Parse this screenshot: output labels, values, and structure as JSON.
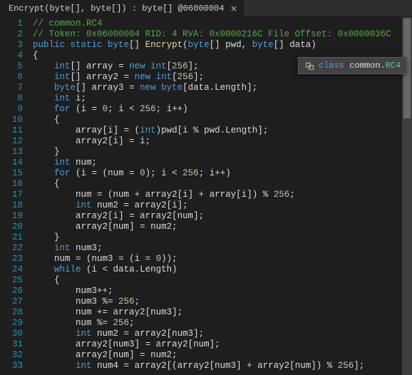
{
  "tab": {
    "title": "Encrypt(byte[], byte[]) : byte[] @06000004"
  },
  "tooltip": {
    "keyword": "class",
    "namespace": "common",
    "class_name": "RC4"
  },
  "colors": {
    "background": "#1e1e1e",
    "comment": "#57a64a",
    "keyword": "#569cd6",
    "typename": "#4ec9b0",
    "method": "#dcdcaa",
    "number": "#b5cea8",
    "linenum": "#2b91af"
  },
  "code_lines": [
    {
      "n": 1,
      "tokens": [
        [
          "comment",
          "// common.RC4"
        ]
      ]
    },
    {
      "n": 2,
      "tokens": [
        [
          "comment",
          "// Token: 0x06000004 RID: 4 RVA: 0x0000216C File Offset: 0x0000036C"
        ]
      ]
    },
    {
      "n": 3,
      "tokens": [
        [
          "key",
          "public "
        ],
        [
          "key",
          "static "
        ],
        [
          "key",
          "byte"
        ],
        [
          "plain",
          "[] "
        ],
        [
          "method",
          "Encrypt"
        ],
        [
          "plain",
          "("
        ],
        [
          "key",
          "byte"
        ],
        [
          "plain",
          "[] "
        ],
        [
          "var",
          "pwd"
        ],
        [
          "plain",
          ", "
        ],
        [
          "key",
          "byte"
        ],
        [
          "plain",
          "[] "
        ],
        [
          "var",
          "data"
        ],
        [
          "plain",
          ")"
        ]
      ]
    },
    {
      "n": 4,
      "tokens": [
        [
          "plain",
          "{"
        ]
      ]
    },
    {
      "n": 5,
      "tokens": [
        [
          "plain",
          "    "
        ],
        [
          "key",
          "int"
        ],
        [
          "plain",
          "[] "
        ],
        [
          "var",
          "array"
        ],
        [
          "plain",
          " = "
        ],
        [
          "key",
          "new "
        ],
        [
          "key",
          "int"
        ],
        [
          "plain",
          "["
        ],
        [
          "num",
          "256"
        ],
        [
          "plain",
          "];"
        ]
      ]
    },
    {
      "n": 6,
      "tokens": [
        [
          "plain",
          "    "
        ],
        [
          "key",
          "int"
        ],
        [
          "plain",
          "[] "
        ],
        [
          "var",
          "array2"
        ],
        [
          "plain",
          " = "
        ],
        [
          "key",
          "new "
        ],
        [
          "key",
          "int"
        ],
        [
          "plain",
          "["
        ],
        [
          "num",
          "256"
        ],
        [
          "plain",
          "];"
        ]
      ]
    },
    {
      "n": 7,
      "tokens": [
        [
          "plain",
          "    "
        ],
        [
          "key",
          "byte"
        ],
        [
          "plain",
          "[] "
        ],
        [
          "var",
          "array3"
        ],
        [
          "plain",
          " = "
        ],
        [
          "key",
          "new "
        ],
        [
          "key",
          "byte"
        ],
        [
          "plain",
          "["
        ],
        [
          "var",
          "data"
        ],
        [
          "plain",
          "."
        ],
        [
          "prop",
          "Length"
        ],
        [
          "plain",
          "];"
        ]
      ]
    },
    {
      "n": 8,
      "tokens": [
        [
          "plain",
          "    "
        ],
        [
          "key",
          "int "
        ],
        [
          "var",
          "i"
        ],
        [
          "plain",
          ";"
        ]
      ]
    },
    {
      "n": 9,
      "tokens": [
        [
          "plain",
          "    "
        ],
        [
          "key",
          "for "
        ],
        [
          "plain",
          "("
        ],
        [
          "var",
          "i"
        ],
        [
          "plain",
          " = "
        ],
        [
          "num",
          "0"
        ],
        [
          "plain",
          "; "
        ],
        [
          "var",
          "i"
        ],
        [
          "plain",
          " < "
        ],
        [
          "num",
          "256"
        ],
        [
          "plain",
          "; "
        ],
        [
          "var",
          "i"
        ],
        [
          "plain",
          "++)"
        ]
      ]
    },
    {
      "n": 10,
      "tokens": [
        [
          "plain",
          "    {"
        ]
      ]
    },
    {
      "n": 11,
      "tokens": [
        [
          "plain",
          "        "
        ],
        [
          "var",
          "array"
        ],
        [
          "plain",
          "["
        ],
        [
          "var",
          "i"
        ],
        [
          "plain",
          "] = ("
        ],
        [
          "key",
          "int"
        ],
        [
          "plain",
          ")"
        ],
        [
          "var",
          "pwd"
        ],
        [
          "plain",
          "["
        ],
        [
          "var",
          "i"
        ],
        [
          "plain",
          " % "
        ],
        [
          "var",
          "pwd"
        ],
        [
          "plain",
          "."
        ],
        [
          "prop",
          "Length"
        ],
        [
          "plain",
          "];"
        ]
      ]
    },
    {
      "n": 12,
      "tokens": [
        [
          "plain",
          "        "
        ],
        [
          "var",
          "array2"
        ],
        [
          "plain",
          "["
        ],
        [
          "var",
          "i"
        ],
        [
          "plain",
          "] = "
        ],
        [
          "var",
          "i"
        ],
        [
          "plain",
          ";"
        ]
      ]
    },
    {
      "n": 13,
      "tokens": [
        [
          "plain",
          "    }"
        ]
      ]
    },
    {
      "n": 14,
      "tokens": [
        [
          "plain",
          "    "
        ],
        [
          "key",
          "int "
        ],
        [
          "var",
          "num"
        ],
        [
          "plain",
          ";"
        ]
      ]
    },
    {
      "n": 15,
      "tokens": [
        [
          "plain",
          "    "
        ],
        [
          "key",
          "for "
        ],
        [
          "plain",
          "("
        ],
        [
          "var",
          "i"
        ],
        [
          "plain",
          " = ("
        ],
        [
          "var",
          "num"
        ],
        [
          "plain",
          " = "
        ],
        [
          "num",
          "0"
        ],
        [
          "plain",
          "); "
        ],
        [
          "var",
          "i"
        ],
        [
          "plain",
          " < "
        ],
        [
          "num",
          "256"
        ],
        [
          "plain",
          "; "
        ],
        [
          "var",
          "i"
        ],
        [
          "plain",
          "++)"
        ]
      ]
    },
    {
      "n": 16,
      "tokens": [
        [
          "plain",
          "    {"
        ]
      ]
    },
    {
      "n": 17,
      "tokens": [
        [
          "plain",
          "        "
        ],
        [
          "var",
          "num"
        ],
        [
          "plain",
          " = ("
        ],
        [
          "var",
          "num"
        ],
        [
          "plain",
          " + "
        ],
        [
          "var",
          "array2"
        ],
        [
          "plain",
          "["
        ],
        [
          "var",
          "i"
        ],
        [
          "plain",
          "] + "
        ],
        [
          "var",
          "array"
        ],
        [
          "plain",
          "["
        ],
        [
          "var",
          "i"
        ],
        [
          "plain",
          "]) % "
        ],
        [
          "num",
          "256"
        ],
        [
          "plain",
          ";"
        ]
      ]
    },
    {
      "n": 18,
      "tokens": [
        [
          "plain",
          "        "
        ],
        [
          "key",
          "int "
        ],
        [
          "var",
          "num2"
        ],
        [
          "plain",
          " = "
        ],
        [
          "var",
          "array2"
        ],
        [
          "plain",
          "["
        ],
        [
          "var",
          "i"
        ],
        [
          "plain",
          "];"
        ]
      ]
    },
    {
      "n": 19,
      "tokens": [
        [
          "plain",
          "        "
        ],
        [
          "var",
          "array2"
        ],
        [
          "plain",
          "["
        ],
        [
          "var",
          "i"
        ],
        [
          "plain",
          "] = "
        ],
        [
          "var",
          "array2"
        ],
        [
          "plain",
          "["
        ],
        [
          "var",
          "num"
        ],
        [
          "plain",
          "];"
        ]
      ]
    },
    {
      "n": 20,
      "tokens": [
        [
          "plain",
          "        "
        ],
        [
          "var",
          "array2"
        ],
        [
          "plain",
          "["
        ],
        [
          "var",
          "num"
        ],
        [
          "plain",
          "] = "
        ],
        [
          "var",
          "num2"
        ],
        [
          "plain",
          ";"
        ]
      ]
    },
    {
      "n": 21,
      "tokens": [
        [
          "plain",
          "    }"
        ]
      ]
    },
    {
      "n": 22,
      "tokens": [
        [
          "plain",
          "    "
        ],
        [
          "key",
          "int "
        ],
        [
          "var",
          "num3"
        ],
        [
          "plain",
          ";"
        ]
      ]
    },
    {
      "n": 23,
      "tokens": [
        [
          "plain",
          "    "
        ],
        [
          "var",
          "num"
        ],
        [
          "plain",
          " = ("
        ],
        [
          "var",
          "num3"
        ],
        [
          "plain",
          " = ("
        ],
        [
          "var",
          "i"
        ],
        [
          "plain",
          " = "
        ],
        [
          "num",
          "0"
        ],
        [
          "plain",
          "));"
        ]
      ]
    },
    {
      "n": 24,
      "tokens": [
        [
          "plain",
          "    "
        ],
        [
          "key",
          "while "
        ],
        [
          "plain",
          "("
        ],
        [
          "var",
          "i"
        ],
        [
          "plain",
          " < "
        ],
        [
          "var",
          "data"
        ],
        [
          "plain",
          "."
        ],
        [
          "prop",
          "Length"
        ],
        [
          "plain",
          ")"
        ]
      ]
    },
    {
      "n": 25,
      "tokens": [
        [
          "plain",
          "    {"
        ]
      ]
    },
    {
      "n": 26,
      "tokens": [
        [
          "plain",
          "        "
        ],
        [
          "var",
          "num3"
        ],
        [
          "plain",
          "++;"
        ]
      ]
    },
    {
      "n": 27,
      "tokens": [
        [
          "plain",
          "        "
        ],
        [
          "var",
          "num3"
        ],
        [
          "plain",
          " %= "
        ],
        [
          "num",
          "256"
        ],
        [
          "plain",
          ";"
        ]
      ]
    },
    {
      "n": 28,
      "tokens": [
        [
          "plain",
          "        "
        ],
        [
          "var",
          "num"
        ],
        [
          "plain",
          " += "
        ],
        [
          "var",
          "array2"
        ],
        [
          "plain",
          "["
        ],
        [
          "var",
          "num3"
        ],
        [
          "plain",
          "];"
        ]
      ]
    },
    {
      "n": 29,
      "tokens": [
        [
          "plain",
          "        "
        ],
        [
          "var",
          "num"
        ],
        [
          "plain",
          " %= "
        ],
        [
          "num",
          "256"
        ],
        [
          "plain",
          ";"
        ]
      ]
    },
    {
      "n": 30,
      "tokens": [
        [
          "plain",
          "        "
        ],
        [
          "key",
          "int "
        ],
        [
          "var",
          "num2"
        ],
        [
          "plain",
          " = "
        ],
        [
          "var",
          "array2"
        ],
        [
          "plain",
          "["
        ],
        [
          "var",
          "num3"
        ],
        [
          "plain",
          "];"
        ]
      ]
    },
    {
      "n": 31,
      "tokens": [
        [
          "plain",
          "        "
        ],
        [
          "var",
          "array2"
        ],
        [
          "plain",
          "["
        ],
        [
          "var",
          "num3"
        ],
        [
          "plain",
          "] = "
        ],
        [
          "var",
          "array2"
        ],
        [
          "plain",
          "["
        ],
        [
          "var",
          "num"
        ],
        [
          "plain",
          "];"
        ]
      ]
    },
    {
      "n": 32,
      "tokens": [
        [
          "plain",
          "        "
        ],
        [
          "var",
          "array2"
        ],
        [
          "plain",
          "["
        ],
        [
          "var",
          "num"
        ],
        [
          "plain",
          "] = "
        ],
        [
          "var",
          "num2"
        ],
        [
          "plain",
          ";"
        ]
      ]
    },
    {
      "n": 33,
      "tokens": [
        [
          "plain",
          "        "
        ],
        [
          "key",
          "int "
        ],
        [
          "var",
          "num4"
        ],
        [
          "plain",
          " = "
        ],
        [
          "var",
          "array2"
        ],
        [
          "plain",
          "[("
        ],
        [
          "var",
          "array2"
        ],
        [
          "plain",
          "["
        ],
        [
          "var",
          "num3"
        ],
        [
          "plain",
          "] + "
        ],
        [
          "var",
          "array2"
        ],
        [
          "plain",
          "["
        ],
        [
          "var",
          "num"
        ],
        [
          "plain",
          "]) % "
        ],
        [
          "num",
          "256"
        ],
        [
          "plain",
          "];"
        ]
      ]
    }
  ]
}
